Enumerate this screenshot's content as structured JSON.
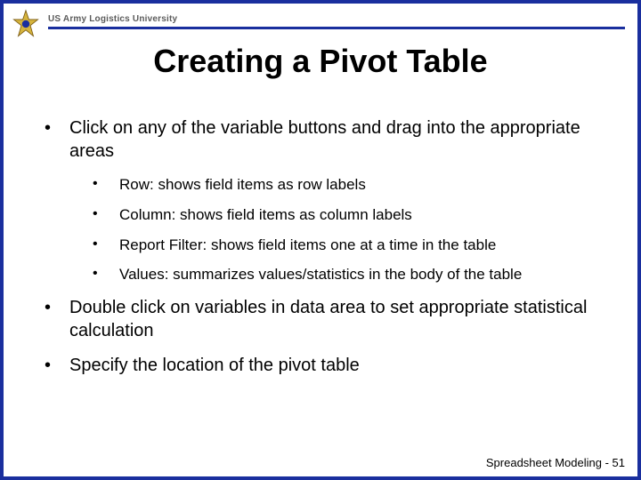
{
  "header": {
    "org": "US Army Logistics University"
  },
  "title": "Creating a Pivot Table",
  "bullets": [
    {
      "text": "Click on any of the variable buttons and drag into the appropriate areas",
      "sub": [
        "Row:  shows field items as row labels",
        "Column:  shows field items as column labels",
        "Report Filter:  shows field items one at a time in the table",
        "Values:  summarizes values/statistics in the body of the table"
      ]
    },
    {
      "text": "Double click on variables in data area to set appropriate statistical calculation"
    },
    {
      "text": "Specify the location of the pivot table"
    }
  ],
  "footer": "Spreadsheet Modeling - 51"
}
